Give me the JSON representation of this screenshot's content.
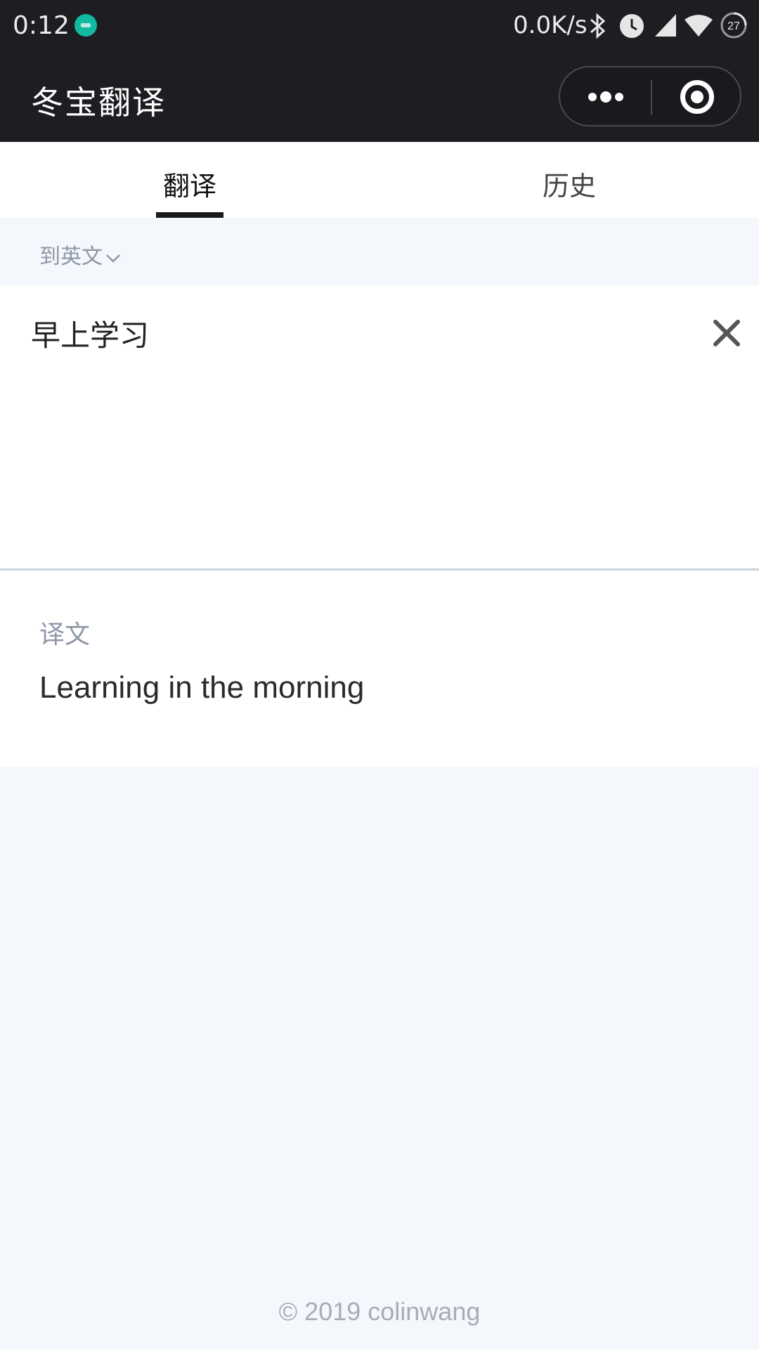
{
  "status_bar": {
    "time": "0:12",
    "network_speed": "0.0K/s",
    "battery_level": "27",
    "icons": [
      "app-notification-icon",
      "bluetooth-icon",
      "alarm-icon",
      "signal-icon",
      "wifi-icon",
      "battery-icon"
    ]
  },
  "header": {
    "title": "冬宝翻译"
  },
  "tabs": [
    {
      "label": "翻译",
      "active": true
    },
    {
      "label": "历史",
      "active": false
    }
  ],
  "language": {
    "selected": "到英文"
  },
  "input": {
    "value": "早上学习"
  },
  "output": {
    "label": "译文",
    "text": "Learning in the morning"
  },
  "footer": {
    "copyright": "© 2019 colinwang"
  },
  "colors": {
    "header_bg": "#1e1d22",
    "page_bg": "#f4f8fc",
    "muted_text": "#8e97a6"
  }
}
